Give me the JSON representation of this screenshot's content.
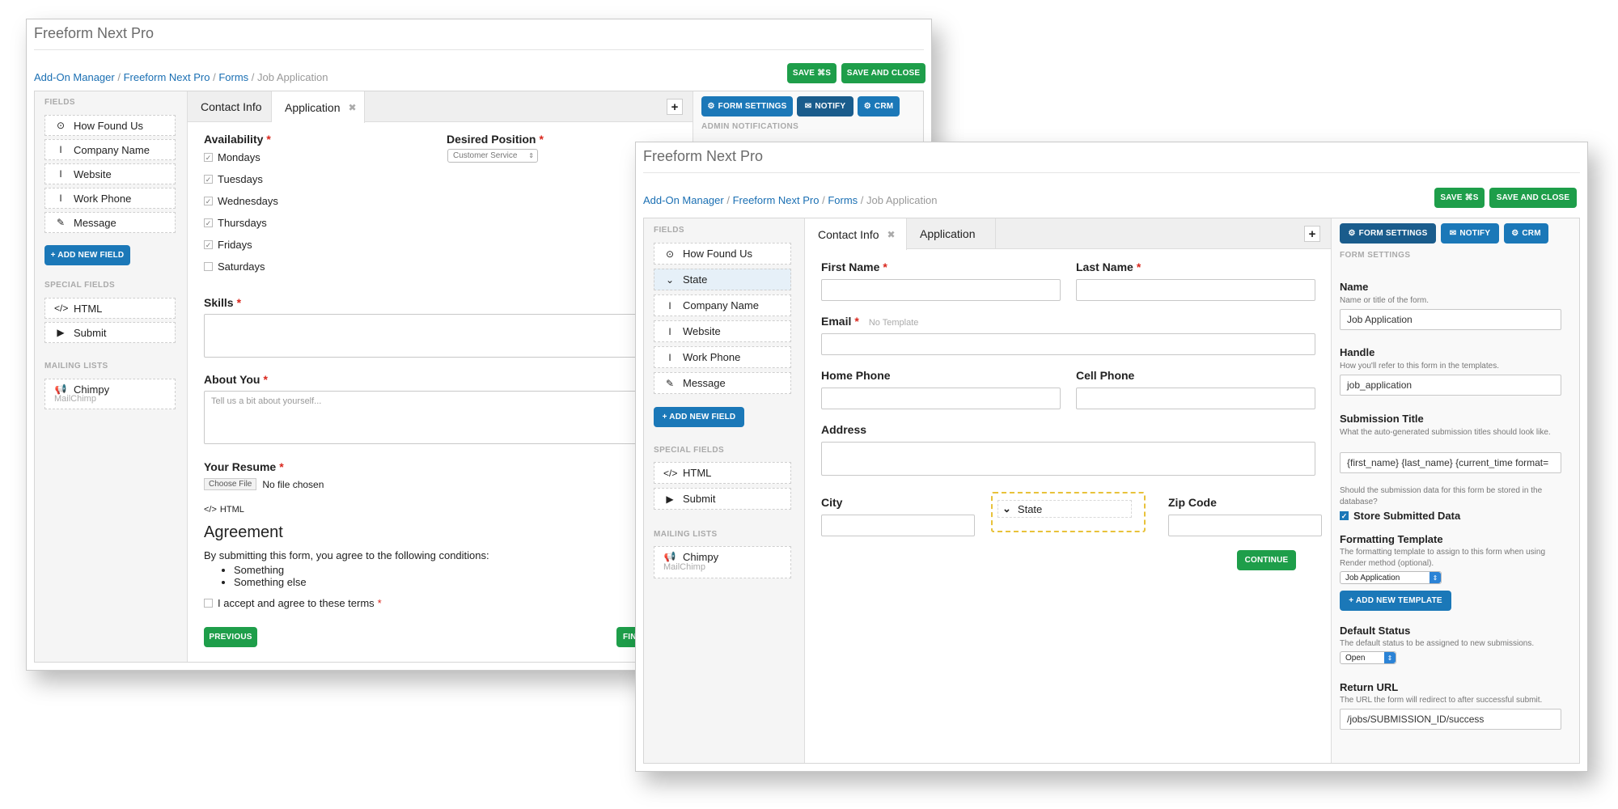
{
  "back": {
    "title": "Freeform Next Pro",
    "breadcrumb": {
      "addon_manager": "Add-On Manager",
      "freeform": "Freeform Next Pro",
      "forms": "Forms",
      "current": "Job Application"
    },
    "save_label": "SAVE ⌘S",
    "save_close_label": "SAVE AND CLOSE",
    "fields_heading": "FIELDS",
    "fields": [
      "How Found Us",
      "Company Name",
      "Website",
      "Work Phone",
      "Message"
    ],
    "add_field_label": "+ ADD NEW FIELD",
    "special_heading": "SPECIAL FIELDS",
    "special": [
      "HTML",
      "Submit"
    ],
    "mailing_heading": "MAILING LISTS",
    "mailing": {
      "name": "Chimpy",
      "sub": "MailChimp"
    },
    "tabs": [
      "Contact Info",
      "Application"
    ],
    "right_buttons": {
      "form_settings": "FORM SETTINGS",
      "notify": "NOTIFY",
      "crm": "CRM"
    },
    "right_heading": "ADMIN NOTIFICATIONS",
    "availability_label": "Availability",
    "days": [
      {
        "label": "Mondays",
        "checked": true
      },
      {
        "label": "Tuesdays",
        "checked": true
      },
      {
        "label": "Wednesdays",
        "checked": true
      },
      {
        "label": "Thursdays",
        "checked": true
      },
      {
        "label": "Fridays",
        "checked": true
      },
      {
        "label": "Saturdays",
        "checked": false
      }
    ],
    "position_label": "Desired Position",
    "position_value": "Customer Service",
    "skills_label": "Skills",
    "about_label": "About You",
    "about_placeholder": "Tell us a bit about yourself...",
    "resume_label": "Your Resume",
    "choose_file": "Choose File",
    "no_file": "No file chosen",
    "html_label": "HTML",
    "agreement_title": "Agreement",
    "agreement_text": "By submitting this form, you agree to the following conditions:",
    "conditions": [
      "Something",
      "Something else"
    ],
    "accept_label": "I accept and agree to these terms",
    "previous_label": "PREVIOUS",
    "finish_label": "FIN"
  },
  "front": {
    "title": "Freeform Next Pro",
    "breadcrumb": {
      "addon_manager": "Add-On Manager",
      "freeform": "Freeform Next Pro",
      "forms": "Forms",
      "current": "Job Application"
    },
    "save_label": "SAVE ⌘S",
    "save_close_label": "SAVE AND CLOSE",
    "fields_heading": "FIELDS",
    "fields": [
      "How Found Us",
      "State",
      "Company Name",
      "Website",
      "Work Phone",
      "Message"
    ],
    "add_field_label": "+ ADD NEW FIELD",
    "special_heading": "SPECIAL FIELDS",
    "special": [
      "HTML",
      "Submit"
    ],
    "mailing_heading": "MAILING LISTS",
    "mailing": {
      "name": "Chimpy",
      "sub": "MailChimp"
    },
    "tabs": [
      "Contact Info",
      "Application"
    ],
    "form": {
      "first_name": "First Name",
      "last_name": "Last Name",
      "email": "Email",
      "no_template": "No Template",
      "home_phone": "Home Phone",
      "cell_phone": "Cell Phone",
      "address": "Address",
      "city": "City",
      "state": "State",
      "zip": "Zip Code",
      "continue_label": "CONTINUE"
    },
    "settings": {
      "form_settings": "FORM SETTINGS",
      "notify": "NOTIFY",
      "crm": "CRM",
      "heading": "FORM SETTINGS",
      "name_label": "Name",
      "name_help": "Name or title of the form.",
      "name_value": "Job Application",
      "handle_label": "Handle",
      "handle_help": "How you'll refer to this form in the templates.",
      "handle_value": "job_application",
      "submission_label": "Submission Title",
      "submission_help": "What the auto-generated submission titles should look like.",
      "submission_value": "{first_name} {last_name} {current_time format=",
      "store_help": "Should the submission data for this form be stored in the database?",
      "store_label": "Store Submitted Data",
      "formatting_label": "Formatting Template",
      "formatting_help": "The formatting template to assign to this form when using Render method (optional).",
      "formatting_value": "Job Application",
      "add_template_label": "+ ADD NEW TEMPLATE",
      "status_label": "Default Status",
      "status_help": "The default status to be assigned to new submissions.",
      "status_value": "Open",
      "return_label": "Return URL",
      "return_help": "The URL the form will redirect to after successful submit.",
      "return_value": "/jobs/SUBMISSION_ID/success"
    }
  },
  "colors": {
    "green": "#1e9e4a",
    "blue": "#1b78b8",
    "link": "#1a6fb3",
    "required": "#d9261c",
    "highlight": "#e8c23a"
  }
}
